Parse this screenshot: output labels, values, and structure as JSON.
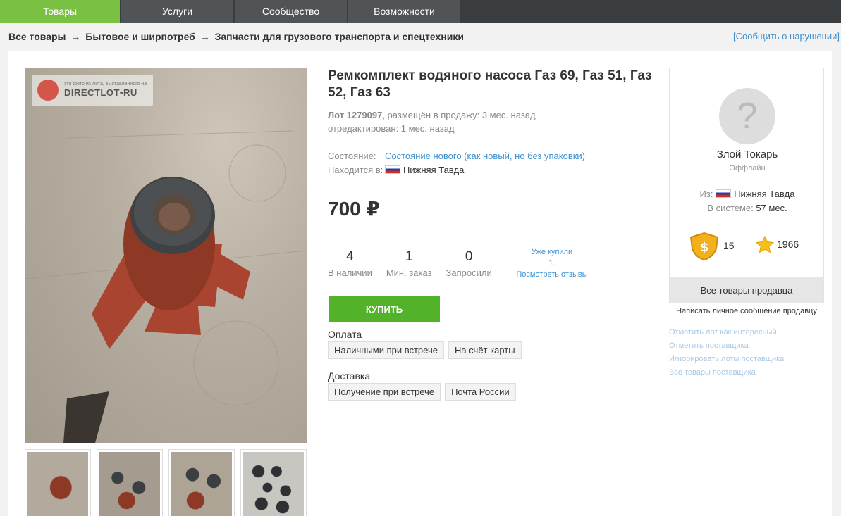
{
  "nav": {
    "tabs": [
      "Товары",
      "Услуги",
      "Сообщество",
      "Возможности"
    ]
  },
  "breadcrumb": {
    "items": [
      "Все товары",
      "Бытовое и ширпотреб",
      "Запчасти для грузового транспорта и спецтехники"
    ],
    "separator": "→"
  },
  "report_link": "[Сообщить о нарушении]",
  "photo": {
    "watermark": "DIRECTLOT",
    "watermark_suffix": "RU",
    "watermark_note": "это фото из лота, выставленного на"
  },
  "item": {
    "title": "Ремкомплект водяного насоса Газ 69, Газ 51, Газ 52, Газ 63",
    "lot_label": "Лот 1279097",
    "posted": ", размещён в продажу: 3 мес. назад",
    "edited": "отредактирован: 1 мес. назад",
    "condition_label": "Состояние:",
    "condition_value": "Состояние нового (как новый, но без упаковки)",
    "location_label": "Находится в:",
    "location_value": "Нижняя Тавда",
    "price": "700 ₽"
  },
  "stats": [
    {
      "num": "4",
      "cap": "В наличии"
    },
    {
      "num": "1",
      "cap": "Мин. заказ"
    },
    {
      "num": "0",
      "cap": "Запросили"
    }
  ],
  "bought": {
    "line1": "Уже купили",
    "line2": "1.",
    "line3": "Посмотреть отзывы"
  },
  "buy_button": "КУПИТЬ",
  "payment": {
    "title": "Оплата",
    "options": [
      "Наличными при встрече",
      "На счёт карты"
    ]
  },
  "delivery": {
    "title": "Доставка",
    "options": [
      "Получение при встрече",
      "Почта России"
    ]
  },
  "seller": {
    "name": "Злой Токарь",
    "status": "Оффлайн",
    "from_label": "Из:",
    "from_value": "Нижняя Тавда",
    "system_label": "В системе:",
    "system_value": "57 мес.",
    "rank_value": "15",
    "rating_value": "1966",
    "all_goods": "Все товары продавца",
    "message": "Написать личное сообщение продавцу"
  },
  "side_links": [
    "Отметить лот как интересный",
    "Отметить поставщика",
    "Игнорировать лоты поставщика",
    "Все товары поставщика"
  ],
  "colors": {
    "accent_green": "#7ac143",
    "buy_green": "#52b32b",
    "link_blue": "#3b8fd0",
    "nav_dark": "#3a3d40"
  }
}
